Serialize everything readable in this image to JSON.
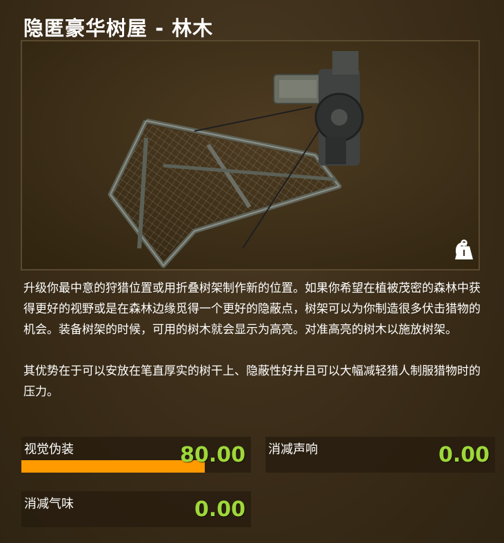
{
  "item": {
    "title": "隐匿豪华树屋 - 林木",
    "weight": "6",
    "weight_icon": "weight-icon"
  },
  "description": {
    "paragraph1": "升级你最中意的狩猎位置或用折叠树架制作新的位置。如果你希望在植被茂密的森林中获得更好的视野或是在森林边缘觅得一个更好的隐蔽点，树架可以为你制造很多伏击猎物的机会。装备树架的时候，可用的树木就会显示为高亮。对准高亮的树木以施放树架。",
    "paragraph2": "其优势在于可以安放在笔直厚实的树干上、隐蔽性好并且可以大幅减轻猎人制服猎物时的压力。"
  },
  "stats": [
    {
      "label": "视觉伪装",
      "value": "80.00",
      "fraction": 0.8
    },
    {
      "label": "消减声响",
      "value": "0.00",
      "fraction": 0
    },
    {
      "label": "消减气味",
      "value": "0.00",
      "fraction": 0
    }
  ],
  "colors": {
    "accent_bar": "#ff9a00",
    "value_green": "#9ed83a"
  }
}
